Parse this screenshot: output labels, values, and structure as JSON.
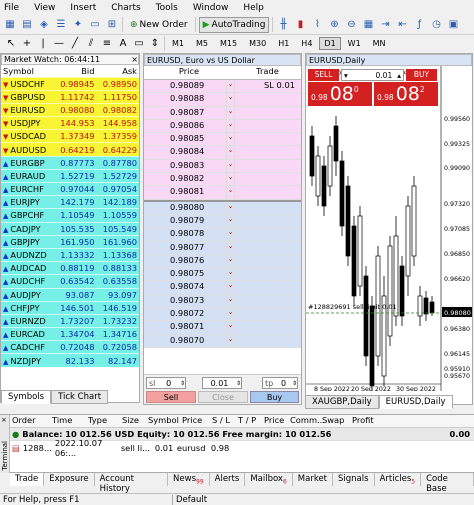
{
  "menu": [
    "File",
    "View",
    "Insert",
    "Charts",
    "Tools",
    "Window",
    "Help"
  ],
  "toolbar": {
    "new_order": "New Order",
    "autotrading": "AutoTrading"
  },
  "timeframes": [
    "M1",
    "M5",
    "M15",
    "M30",
    "H1",
    "H4",
    "D1",
    "W1",
    "MN"
  ],
  "timeframe_active": "D1",
  "market_watch": {
    "title": "Market Watch: 06:44:11",
    "columns": [
      "Symbol",
      "Bid",
      "Ask"
    ],
    "rows": [
      {
        "symbol": "USDCHF",
        "bid": "0.98945",
        "ask": "0.98950",
        "color": "#f9f535",
        "dir": "down"
      },
      {
        "symbol": "GBPUSD",
        "bid": "1.11742",
        "ask": "1.11750",
        "color": "#f9f535",
        "dir": "down"
      },
      {
        "symbol": "EURUSD",
        "bid": "0.98080",
        "ask": "0.98082",
        "color": "#f9f535",
        "dir": "down"
      },
      {
        "symbol": "USDJPY",
        "bid": "144.953",
        "ask": "144.958",
        "color": "#f9f535",
        "dir": "down"
      },
      {
        "symbol": "USDCAD",
        "bid": "1.37349",
        "ask": "1.37359",
        "color": "#f9f535",
        "dir": "down"
      },
      {
        "symbol": "AUDUSD",
        "bid": "0.64219",
        "ask": "0.64229",
        "color": "#f9f535",
        "dir": "down"
      },
      {
        "symbol": "EURGBP",
        "bid": "0.87773",
        "ask": "0.87780",
        "color": "#76f0e6",
        "dir": "up"
      },
      {
        "symbol": "EURAUD",
        "bid": "1.52719",
        "ask": "1.52729",
        "color": "#76f0e6",
        "dir": "up"
      },
      {
        "symbol": "EURCHF",
        "bid": "0.97044",
        "ask": "0.97054",
        "color": "#76f0e6",
        "dir": "up"
      },
      {
        "symbol": "EURJPY",
        "bid": "142.179",
        "ask": "142.189",
        "color": "#76f0e6",
        "dir": "up"
      },
      {
        "symbol": "GBPCHF",
        "bid": "1.10549",
        "ask": "1.10559",
        "color": "#76f0e6",
        "dir": "up"
      },
      {
        "symbol": "CADJPY",
        "bid": "105.535",
        "ask": "105.549",
        "color": "#76f0e6",
        "dir": "up"
      },
      {
        "symbol": "GBPJPY",
        "bid": "161.950",
        "ask": "161.960",
        "color": "#76f0e6",
        "dir": "up"
      },
      {
        "symbol": "AUDNZD",
        "bid": "1.13332",
        "ask": "1.13368",
        "color": "#76f0e6",
        "dir": "up"
      },
      {
        "symbol": "AUDCAD",
        "bid": "0.88119",
        "ask": "0.88133",
        "color": "#76f0e6",
        "dir": "up"
      },
      {
        "symbol": "AUDCHF",
        "bid": "0.63542",
        "ask": "0.63558",
        "color": "#76f0e6",
        "dir": "up"
      },
      {
        "symbol": "AUDJPY",
        "bid": "93.087",
        "ask": "93.097",
        "color": "#76f0e6",
        "dir": "up"
      },
      {
        "symbol": "CHFJPY",
        "bid": "146.501",
        "ask": "146.519",
        "color": "#76f0e6",
        "dir": "up"
      },
      {
        "symbol": "EURNZD",
        "bid": "1.73207",
        "ask": "1.73232",
        "color": "#76f0e6",
        "dir": "up"
      },
      {
        "symbol": "EURCAD",
        "bid": "1.34704",
        "ask": "1.34716",
        "color": "#76f0e6",
        "dir": "up"
      },
      {
        "symbol": "CADCHF",
        "bid": "0.72048",
        "ask": "0.72058",
        "color": "#76f0e6",
        "dir": "up"
      },
      {
        "symbol": "NZDJPY",
        "bid": "82.133",
        "ask": "82.147",
        "color": "#76f0e6",
        "dir": "up"
      }
    ],
    "tabs": [
      "Symbols",
      "Tick Chart"
    ]
  },
  "dom": {
    "title": "EURUSD, Euro vs US Dollar",
    "columns": [
      "Price",
      "Trade"
    ],
    "ask_rows": [
      "0.98089",
      "0.98088",
      "0.98087",
      "0.98086",
      "0.98085",
      "0.98084",
      "0.98083",
      "0.98082",
      "0.98081"
    ],
    "sl_label": "SL 0.01",
    "bid_rows": [
      "0.98080",
      "0.98079",
      "0.98078",
      "0.98077",
      "0.98076",
      "0.98075",
      "0.98074",
      "0.98073",
      "0.98072",
      "0.98071",
      "0.98070"
    ],
    "sl_value": "0",
    "volume": "0.01",
    "tp_value": "0",
    "sl_prefix": "sl",
    "tp_prefix": "tp",
    "sell_label": "Sell",
    "close_label": "Close",
    "buy_label": "Buy"
  },
  "chart": {
    "title": "EURUSD,Daily",
    "ohlc": "0.97895 0.98120 0.97858 0.98080",
    "sell_label": "SELL",
    "buy_label": "BUY",
    "volume": "0.01",
    "sell_price_small": "0.98",
    "sell_price_big": "08",
    "sell_price_sup": "0",
    "buy_price_small": "0.98",
    "buy_price_big": "08",
    "buy_price_sup": "2",
    "order_line": "#128829691 sell limit 0.01",
    "axis": [
      "0.99560",
      "0.99325",
      "0.99090",
      "0.98080",
      "0.97320",
      "0.97085",
      "0.96850",
      "0.96620",
      "0.96380",
      "0.96145",
      "0.95910",
      "0.95670"
    ],
    "current_price": "0.98080",
    "dates": [
      "8 Sep 2022",
      "20 Sep 2022",
      "30 Sep 2022"
    ],
    "tabs": [
      "XAUGBP,Daily",
      "EURUSD,Daily"
    ]
  },
  "trade_table": {
    "columns": [
      "Order",
      "Time",
      "Type",
      "Size",
      "Symbol",
      "Price",
      "S / L",
      "T / P",
      "Price",
      "Comm...",
      "Swap",
      "Profit"
    ],
    "balance_line": "Balance: 10 012.56 USD  Equity: 10 012.56  Free margin: 10 012.56",
    "balance_profit": "0.00",
    "row": {
      "order": "1288...",
      "time": "2022.10.07 06:...",
      "type": "sell li...",
      "size": "0.01",
      "symbol": "eurusd",
      "price": "0.98"
    }
  },
  "terminal_tabs": [
    {
      "label": "Trade",
      "badge": ""
    },
    {
      "label": "Exposure",
      "badge": ""
    },
    {
      "label": "Account History",
      "badge": ""
    },
    {
      "label": "News",
      "badge": "99"
    },
    {
      "label": "Alerts",
      "badge": ""
    },
    {
      "label": "Mailbox",
      "badge": "6"
    },
    {
      "label": "Market",
      "badge": ""
    },
    {
      "label": "Signals",
      "badge": ""
    },
    {
      "label": "Articles",
      "badge": "5"
    },
    {
      "label": "Code Base",
      "badge": ""
    }
  ],
  "terminal_label": "Terminal",
  "status": {
    "left": "For Help, press F1",
    "mid": "Default"
  }
}
